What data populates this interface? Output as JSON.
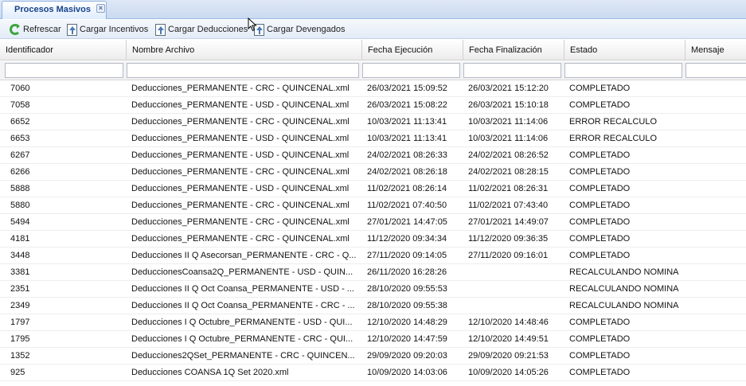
{
  "tab": {
    "label": "Procesos Masivos",
    "close_symbol": "×"
  },
  "toolbar": {
    "refresh_label": "Refrescar",
    "incentivos_label": "Cargar Incentivos",
    "deducciones_label": "Cargar Deducciones",
    "devengados_label": "Cargar Devengados"
  },
  "columns": [
    "Identificador",
    "Nombre Archivo",
    "Fecha Ejecución",
    "Fecha Finalización",
    "Estado",
    "Mensaje"
  ],
  "rows": [
    {
      "id": "7060",
      "archivo": "Deducciones_PERMANENTE - CRC - QUINCENAL.xml",
      "ejecucion": "26/03/2021 15:09:52",
      "finalizacion": "26/03/2021 15:12:20",
      "estado": "COMPLETADO"
    },
    {
      "id": "7058",
      "archivo": "Deducciones_PERMANENTE - USD - QUINCENAL.xml",
      "ejecucion": "26/03/2021 15:08:22",
      "finalizacion": "26/03/2021 15:10:18",
      "estado": "COMPLETADO"
    },
    {
      "id": "6652",
      "archivo": "Deducciones_PERMANENTE - CRC - QUINCENAL.xml",
      "ejecucion": "10/03/2021 11:13:41",
      "finalizacion": "10/03/2021 11:14:06",
      "estado": "ERROR RECALCULO"
    },
    {
      "id": "6653",
      "archivo": "Deducciones_PERMANENTE - USD - QUINCENAL.xml",
      "ejecucion": "10/03/2021 11:13:41",
      "finalizacion": "10/03/2021 11:14:06",
      "estado": "ERROR RECALCULO"
    },
    {
      "id": "6267",
      "archivo": "Deducciones_PERMANENTE - USD - QUINCENAL.xml",
      "ejecucion": "24/02/2021 08:26:33",
      "finalizacion": "24/02/2021 08:26:52",
      "estado": "COMPLETADO"
    },
    {
      "id": "6266",
      "archivo": "Deducciones_PERMANENTE - CRC - QUINCENAL.xml",
      "ejecucion": "24/02/2021 08:26:18",
      "finalizacion": "24/02/2021 08:28:15",
      "estado": "COMPLETADO"
    },
    {
      "id": "5888",
      "archivo": "Deducciones_PERMANENTE - USD - QUINCENAL.xml",
      "ejecucion": "11/02/2021 08:26:14",
      "finalizacion": "11/02/2021 08:26:31",
      "estado": "COMPLETADO"
    },
    {
      "id": "5880",
      "archivo": "Deducciones_PERMANENTE - CRC - QUINCENAL.xml",
      "ejecucion": "11/02/2021 07:40:50",
      "finalizacion": "11/02/2021 07:43:40",
      "estado": "COMPLETADO"
    },
    {
      "id": "5494",
      "archivo": "Deducciones_PERMANENTE - CRC - QUINCENAL.xml",
      "ejecucion": "27/01/2021 14:47:05",
      "finalizacion": "27/01/2021 14:49:07",
      "estado": "COMPLETADO"
    },
    {
      "id": "4181",
      "archivo": "Deducciones_PERMANENTE - CRC - QUINCENAL.xml",
      "ejecucion": "11/12/2020 09:34:34",
      "finalizacion": "11/12/2020 09:36:35",
      "estado": "COMPLETADO"
    },
    {
      "id": "3448",
      "archivo": "Deducciones II Q Asecorsan_PERMANENTE - CRC - Q...",
      "ejecucion": "27/11/2020 09:14:05",
      "finalizacion": "27/11/2020 09:16:01",
      "estado": "COMPLETADO"
    },
    {
      "id": "3381",
      "archivo": "DeduccionesCoansa2Q_PERMANENTE - USD - QUIN...",
      "ejecucion": "26/11/2020 16:28:26",
      "finalizacion": "",
      "estado": "RECALCULANDO NOMINA"
    },
    {
      "id": "2351",
      "archivo": "Deducciones II Q Oct Coansa_PERMANENTE - USD - ...",
      "ejecucion": "28/10/2020 09:55:53",
      "finalizacion": "",
      "estado": "RECALCULANDO NOMINA"
    },
    {
      "id": "2349",
      "archivo": "Deducciones II Q Oct Coansa_PERMANENTE - CRC - ...",
      "ejecucion": "28/10/2020 09:55:38",
      "finalizacion": "",
      "estado": "RECALCULANDO NOMINA"
    },
    {
      "id": "1797",
      "archivo": "Deducciones I Q Octubre_PERMANENTE - USD - QUI...",
      "ejecucion": "12/10/2020 14:48:29",
      "finalizacion": "12/10/2020 14:48:46",
      "estado": "COMPLETADO"
    },
    {
      "id": "1795",
      "archivo": "Deducciones I Q Octubre_PERMANENTE - CRC - QUI...",
      "ejecucion": "12/10/2020 14:47:59",
      "finalizacion": "12/10/2020 14:49:51",
      "estado": "COMPLETADO"
    },
    {
      "id": "1352",
      "archivo": "Deducciones2QSet_PERMANENTE - CRC - QUINCEN...",
      "ejecucion": "29/09/2020 09:20:03",
      "finalizacion": "29/09/2020 09:21:53",
      "estado": "COMPLETADO"
    },
    {
      "id": "925",
      "archivo": "Deducciones COANSA 1Q Set 2020.xml",
      "ejecucion": "10/09/2020 14:03:06",
      "finalizacion": "10/09/2020 14:05:26",
      "estado": "COMPLETADO"
    }
  ]
}
